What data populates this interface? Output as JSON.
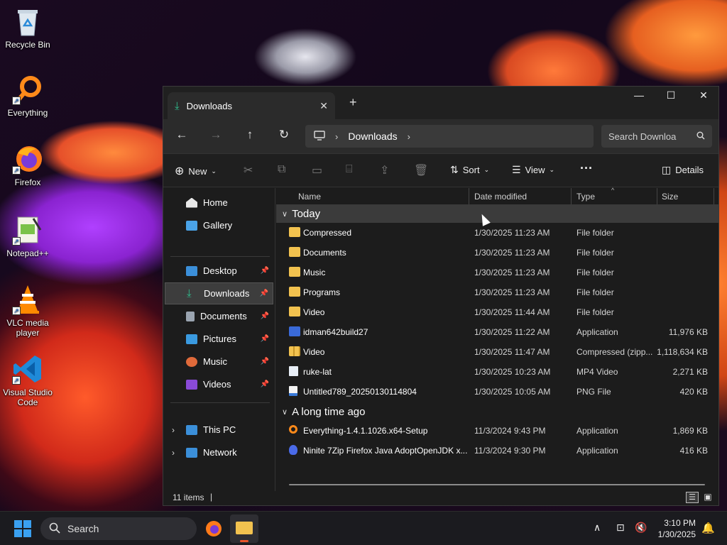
{
  "desktop": {
    "icons": [
      {
        "label": "Recycle Bin",
        "icon": "recycle-bin-icon"
      },
      {
        "label": "Everything",
        "icon": "everything-icon"
      },
      {
        "label": "Firefox",
        "icon": "firefox-icon"
      },
      {
        "label": "Notepad++",
        "icon": "notepadpp-icon"
      },
      {
        "label": "VLC media player",
        "icon": "vlc-icon"
      },
      {
        "label": "Visual Studio Code",
        "icon": "vscode-icon"
      }
    ]
  },
  "window": {
    "tab_title": "Downloads",
    "tab_close": "✕",
    "new_tab": "+",
    "controls": {
      "minimize": "—",
      "maximize": "☐",
      "close": "✕"
    },
    "address": {
      "root_icon": "monitor-icon",
      "crumb": "Downloads"
    },
    "search_placeholder": "Search Downloa",
    "toolbar": {
      "new_label": "New",
      "sort_label": "Sort",
      "view_label": "View",
      "more_label": "···",
      "details_label": "Details"
    },
    "sidebar": {
      "items": [
        {
          "label": "Home",
          "icon": "home-icon",
          "color": "#e8e8e8"
        },
        {
          "label": "Gallery",
          "icon": "gallery-icon",
          "color": "#4aa3e8"
        },
        {
          "label": "Desktop",
          "icon": "desktop-icon",
          "color": "#3b8fd9"
        },
        {
          "label": "Downloads",
          "icon": "download-icon",
          "color": "#2fbf8f"
        },
        {
          "label": "Documents",
          "icon": "documents-icon",
          "color": "#9aa4b0"
        },
        {
          "label": "Pictures",
          "icon": "pictures-icon",
          "color": "#3a9ae0"
        },
        {
          "label": "Music",
          "icon": "music-icon",
          "color": "#e06a3a"
        },
        {
          "label": "Videos",
          "icon": "videos-icon",
          "color": "#8a4ad8"
        },
        {
          "label": "This PC",
          "icon": "this-pc-icon",
          "color": "#3b8fd9"
        },
        {
          "label": "Network",
          "icon": "network-icon",
          "color": "#3b8fd9"
        }
      ]
    },
    "columns": {
      "name": "Name",
      "date": "Date modified",
      "type": "Type",
      "size": "Size"
    },
    "groups": [
      {
        "label": "Today",
        "rows": [
          {
            "name": "Compressed",
            "date": "1/30/2025 11:23 AM",
            "type": "File folder",
            "size": "",
            "icon": "folder-icon"
          },
          {
            "name": "Documents",
            "date": "1/30/2025 11:23 AM",
            "type": "File folder",
            "size": "",
            "icon": "folder-icon"
          },
          {
            "name": "Music",
            "date": "1/30/2025 11:23 AM",
            "type": "File folder",
            "size": "",
            "icon": "folder-icon"
          },
          {
            "name": "Programs",
            "date": "1/30/2025 11:23 AM",
            "type": "File folder",
            "size": "",
            "icon": "folder-icon"
          },
          {
            "name": "Video",
            "date": "1/30/2025 11:44 AM",
            "type": "File folder",
            "size": "",
            "icon": "folder-icon"
          },
          {
            "name": "idman642build27",
            "date": "1/30/2025 11:22 AM",
            "type": "Application",
            "size": "11,976 KB",
            "icon": "installer-icon"
          },
          {
            "name": "Video",
            "date": "1/30/2025 11:47 AM",
            "type": "Compressed (zipp...",
            "size": "1,118,634 KB",
            "icon": "zip-folder-icon"
          },
          {
            "name": "ruke-lat",
            "date": "1/30/2025 10:23 AM",
            "type": "MP4 Video",
            "size": "2,271 KB",
            "icon": "video-file-icon"
          },
          {
            "name": "Untitled789_20250130114804",
            "date": "1/30/2025 10:05 AM",
            "type": "PNG File",
            "size": "420 KB",
            "icon": "image-file-icon"
          }
        ]
      },
      {
        "label": "A long time ago",
        "rows": [
          {
            "name": "Everything-1.4.1.1026.x64-Setup",
            "date": "11/3/2024 9:43 PM",
            "type": "Application",
            "size": "1,869 KB",
            "icon": "everything-icon"
          },
          {
            "name": "Ninite 7Zip Firefox Java AdoptOpenJDK x...",
            "date": "11/3/2024 9:30 PM",
            "type": "Application",
            "size": "416 KB",
            "icon": "ninite-icon"
          }
        ]
      }
    ],
    "status": {
      "item_count": "11 items"
    }
  },
  "taskbar": {
    "search_label": "Search",
    "time": "3:10 PM",
    "date": "1/30/2025"
  }
}
